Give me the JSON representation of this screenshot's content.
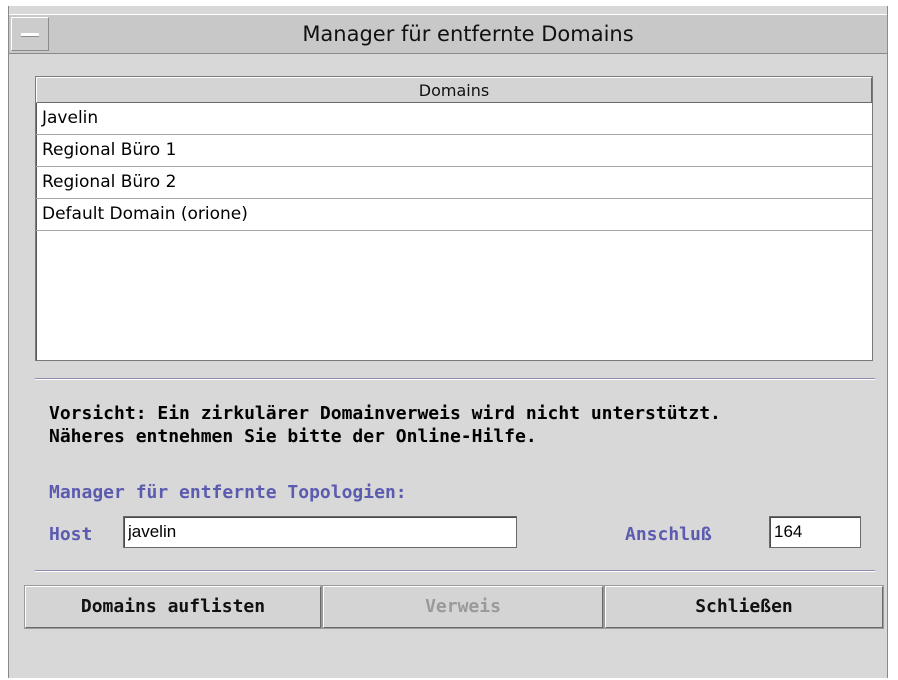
{
  "window": {
    "title": "Manager für entfernte Domains"
  },
  "domains_table": {
    "header": "Domains",
    "rows": [
      "Javelin",
      "Regional Büro 1",
      "Regional Büro 2",
      "Default Domain (orione)"
    ]
  },
  "warning": {
    "line1": "Vorsicht: Ein zirkulärer Domainverweis wird nicht unterstützt.",
    "line2": "Näheres entnehmen Sie bitte der Online-Hilfe."
  },
  "topology": {
    "section_label": "Manager für entfernte Topologien:",
    "host_label": "Host",
    "host_value": "javelin",
    "port_label": "Anschluß",
    "port_value": "164"
  },
  "buttons": {
    "list_domains": "Domains auflisten",
    "reference": "Verweis",
    "close": "Schließen"
  },
  "colors": {
    "label_accent": "#5b5bb0",
    "window_bg": "#d8d8d8",
    "disabled_text": "#9a9a9a"
  }
}
